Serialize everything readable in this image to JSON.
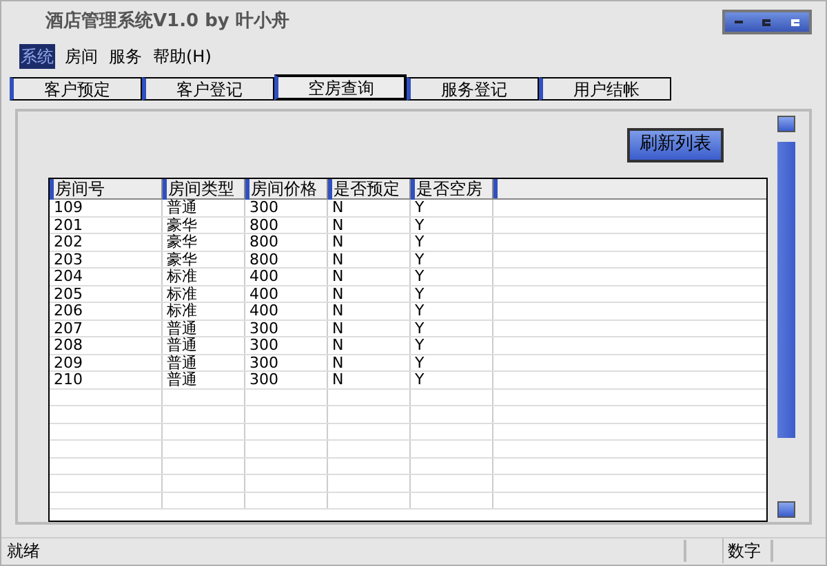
{
  "window": {
    "title": "酒店管理系统V1.0 by 叶小舟"
  },
  "menu": [
    {
      "label": "系统",
      "selected": true
    },
    {
      "label": "房间",
      "selected": false
    },
    {
      "label": "服务",
      "selected": false
    },
    {
      "label": "帮助(H)",
      "selected": false
    }
  ],
  "tabs": [
    {
      "label": "客户预定",
      "selected": false
    },
    {
      "label": "客户登记",
      "selected": false
    },
    {
      "label": "空房查询",
      "selected": true
    },
    {
      "label": "服务登记",
      "selected": false
    },
    {
      "label": "用户结帐",
      "selected": false
    }
  ],
  "refresh_button": "刷新列表",
  "table": {
    "columns": [
      "房间号",
      "房间类型",
      "房间价格",
      "是否预定",
      "是否空房"
    ],
    "rows": [
      [
        "109",
        "普通",
        "300",
        "N",
        "Y"
      ],
      [
        "201",
        "豪华",
        "800",
        "N",
        "Y"
      ],
      [
        "202",
        "豪华",
        "800",
        "N",
        "Y"
      ],
      [
        "203",
        "豪华",
        "800",
        "N",
        "Y"
      ],
      [
        "204",
        "标准",
        "400",
        "N",
        "Y"
      ],
      [
        "205",
        "标准",
        "400",
        "N",
        "Y"
      ],
      [
        "206",
        "标准",
        "400",
        "N",
        "Y"
      ],
      [
        "207",
        "普通",
        "300",
        "N",
        "Y"
      ],
      [
        "208",
        "普通",
        "300",
        "N",
        "Y"
      ],
      [
        "209",
        "普通",
        "300",
        "N",
        "Y"
      ],
      [
        "210",
        "普通",
        "300",
        "N",
        "Y"
      ]
    ]
  },
  "status_bar": {
    "message": "就绪",
    "indicator": "数字"
  }
}
